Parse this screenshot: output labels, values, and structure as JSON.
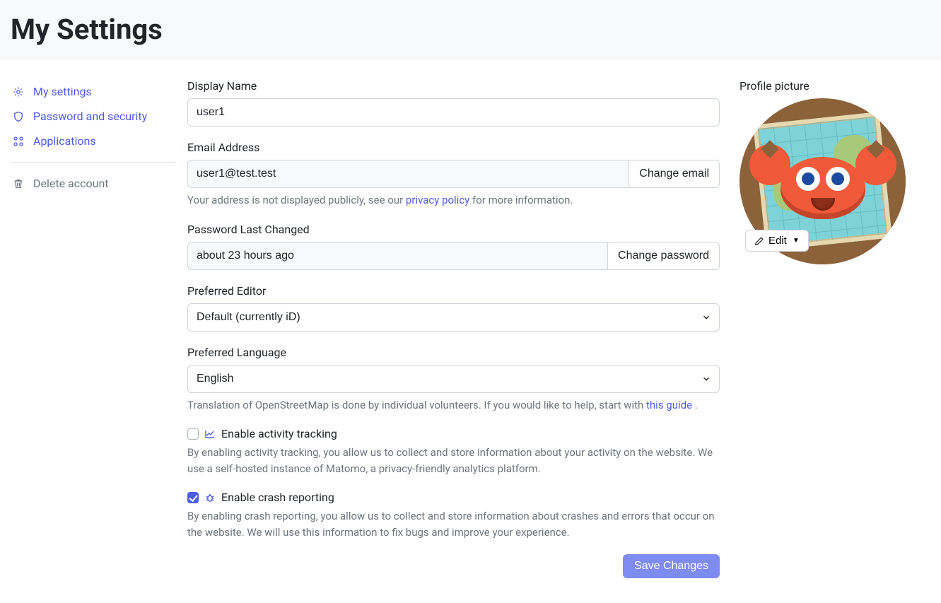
{
  "header": {
    "title": "My Settings"
  },
  "sidebar": {
    "items": [
      {
        "label": "My settings"
      },
      {
        "label": "Password and security"
      },
      {
        "label": "Applications"
      }
    ],
    "delete": {
      "label": "Delete account"
    }
  },
  "form": {
    "display_name": {
      "label": "Display Name",
      "value": "user1"
    },
    "email": {
      "label": "Email Address",
      "value": "user1@test.test",
      "change_btn": "Change email",
      "hint_before": "Your address is not displayed publicly, see our ",
      "hint_link": "privacy policy",
      "hint_after": " for more information."
    },
    "password": {
      "label": "Password Last Changed",
      "value": "about 23 hours ago",
      "change_btn": "Change password"
    },
    "editor": {
      "label": "Preferred Editor",
      "value": "Default (currently iD)"
    },
    "language": {
      "label": "Preferred Language",
      "value": "English",
      "hint_before": "Translation of OpenStreetMap is done by individual volunteers. If you would like to help, start with ",
      "hint_link": "this guide",
      "hint_after": " ."
    },
    "activity": {
      "label": "Enable activity tracking",
      "checked": false,
      "hint": "By enabling activity tracking, you allow us to collect and store information about your activity on the website. We use a self-hosted instance of Matomo, a privacy-friendly analytics platform."
    },
    "crash": {
      "label": "Enable crash reporting",
      "checked": true,
      "hint": "By enabling crash reporting, you allow us to collect and store information about crashes and errors that occur on the website. We will use this information to fix bugs and improve your experience."
    },
    "submit": "Save Changes"
  },
  "profile": {
    "label": "Profile picture",
    "edit": "Edit"
  }
}
